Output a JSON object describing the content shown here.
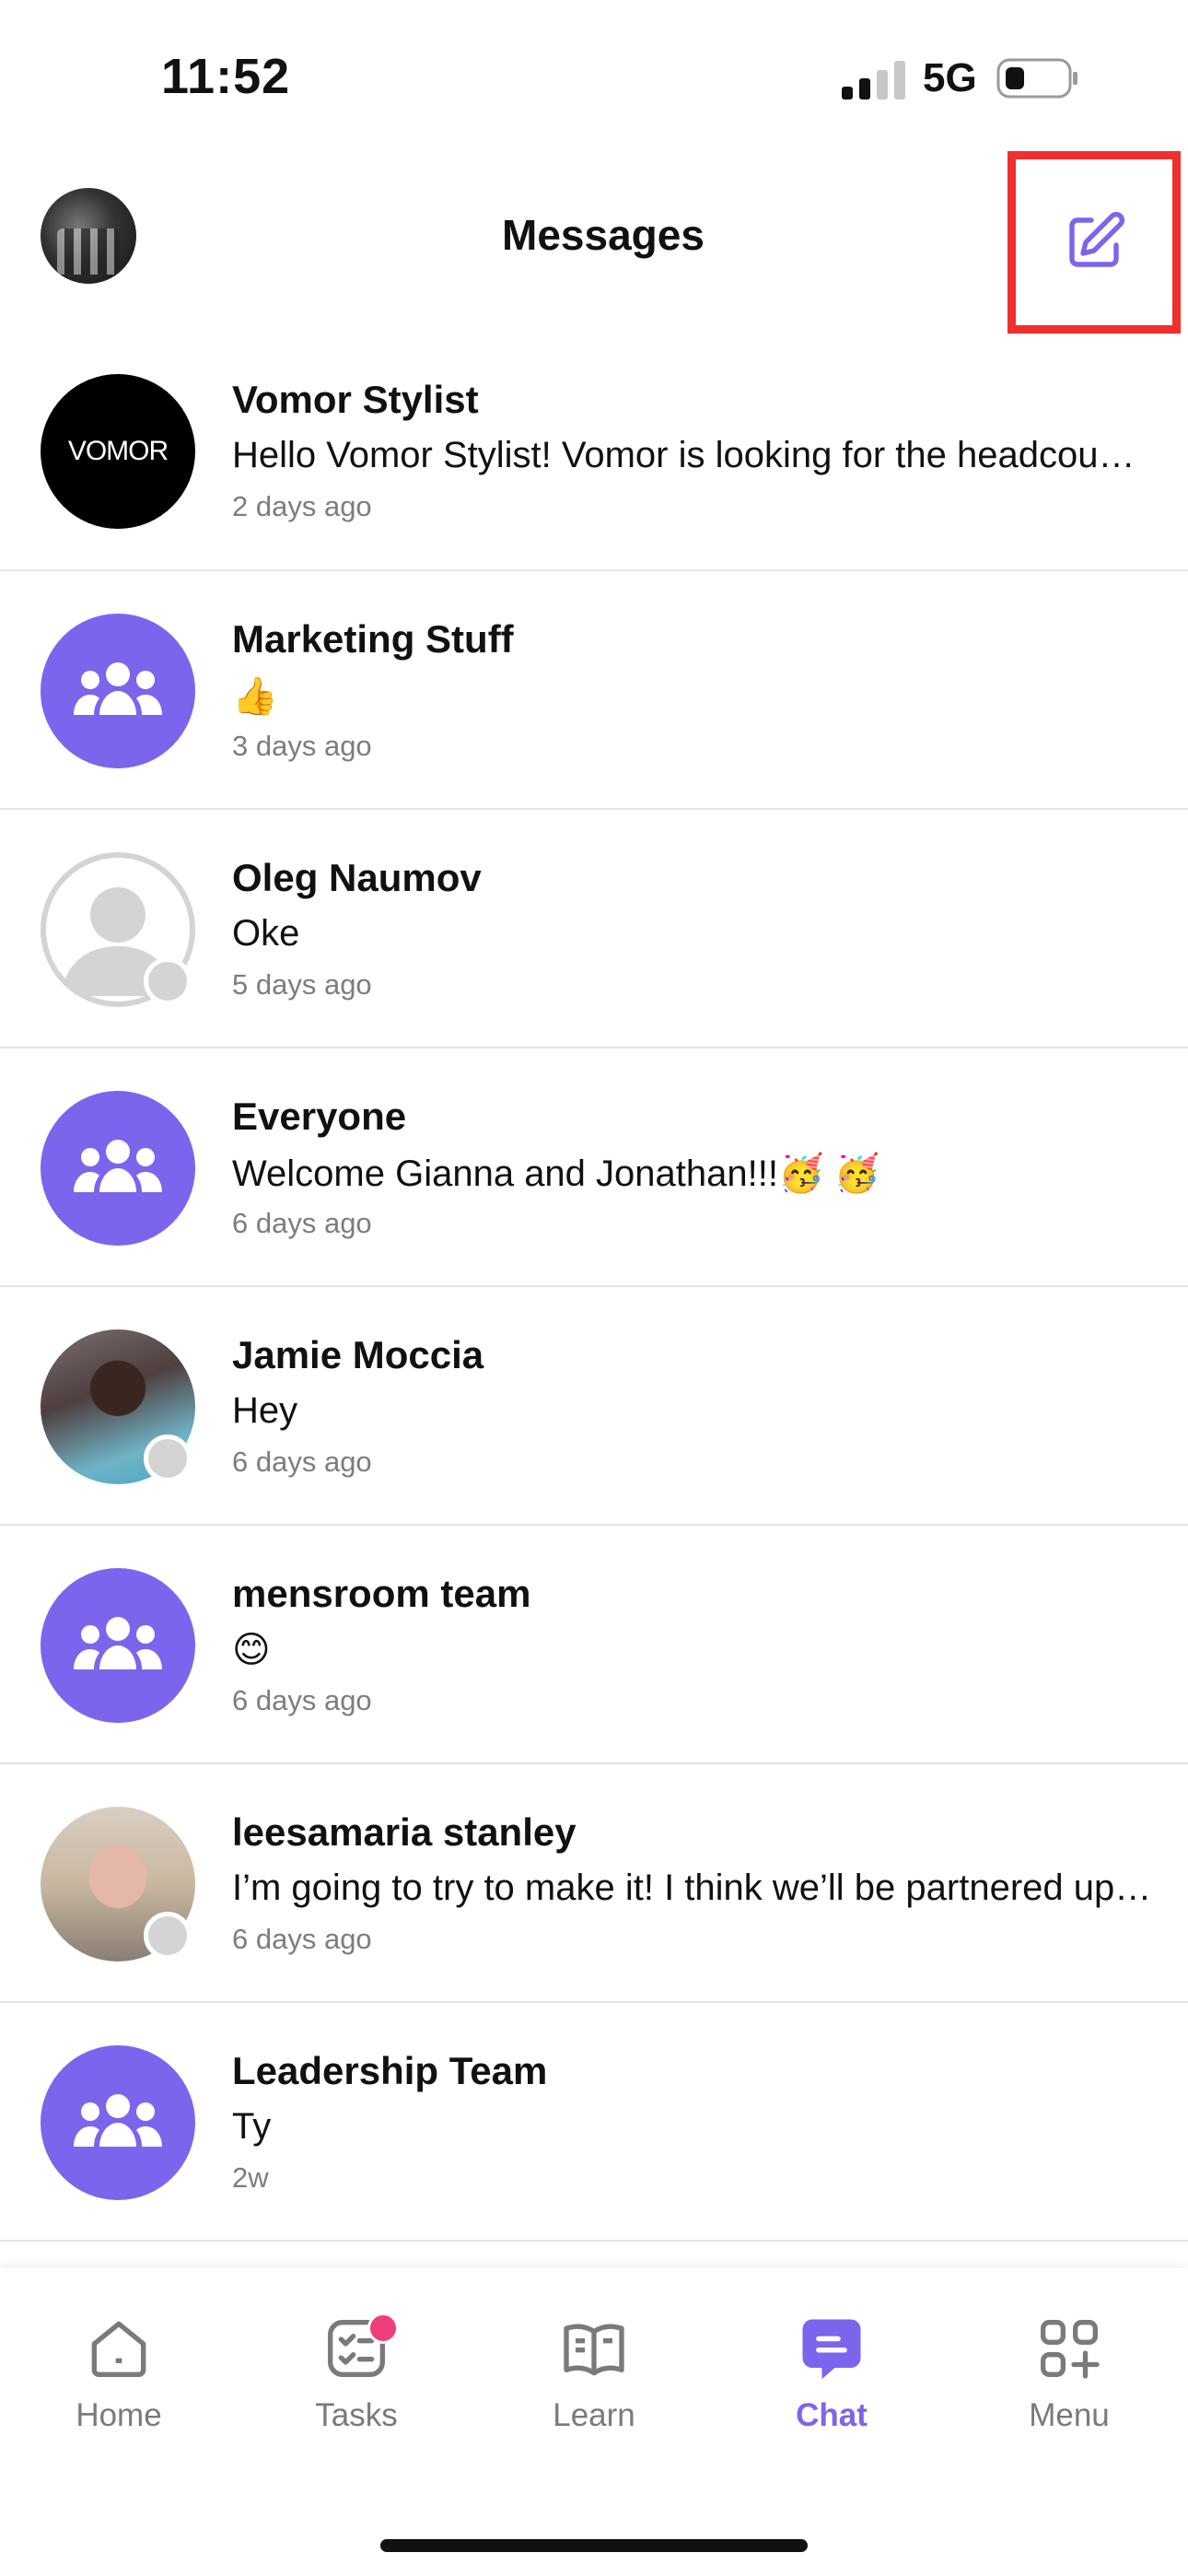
{
  "status_bar": {
    "time": "11:52",
    "network": "5G"
  },
  "header": {
    "title": "Messages"
  },
  "conversations": [
    {
      "name": "Vomor Stylist",
      "preview": "Hello Vomor Stylist! Vomor is looking for the headcount of attendees",
      "time": "2 days ago",
      "avatar_type": "logo",
      "logo_text": "VOMOR"
    },
    {
      "name": "Marketing Stuff",
      "preview": "👍",
      "time": "3 days ago",
      "avatar_type": "group"
    },
    {
      "name": "Oleg Naumov",
      "preview": "Oke",
      "time": "5 days ago",
      "avatar_type": "placeholder"
    },
    {
      "name": "Everyone",
      "preview": "Welcome Gianna and Jonathan!!!🥳 🥳",
      "time": "6 days ago",
      "avatar_type": "group"
    },
    {
      "name": "Jamie Moccia",
      "preview": "Hey",
      "time": "6 days ago",
      "avatar_type": "photo"
    },
    {
      "name": "mensroom team",
      "preview": "😊",
      "time": "6 days ago",
      "avatar_type": "group"
    },
    {
      "name": "leesamaria stanley",
      "preview": "I’m going to try to make it! I think we’ll be partnered up with someone",
      "time": "6 days ago",
      "avatar_type": "photo"
    },
    {
      "name": "Leadership Team",
      "preview": "Ty",
      "time": "2w",
      "avatar_type": "group"
    }
  ],
  "tabs": [
    {
      "label": "Home",
      "icon": "home-icon",
      "active": false
    },
    {
      "label": "Tasks",
      "icon": "tasks-icon",
      "active": false,
      "badge": true
    },
    {
      "label": "Learn",
      "icon": "book-icon",
      "active": false
    },
    {
      "label": "Chat",
      "icon": "chat-icon",
      "active": true
    },
    {
      "label": "Menu",
      "icon": "menu-grid-icon",
      "active": false
    }
  ],
  "colors": {
    "accent": "#7b65ec",
    "highlight_border": "#f0302d",
    "badge": "#ee3f7a",
    "muted_text": "#7d7d7d"
  }
}
